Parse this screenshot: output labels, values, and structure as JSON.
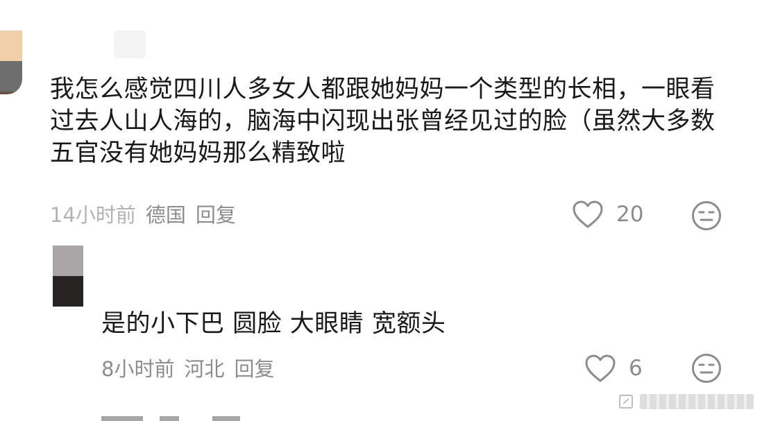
{
  "comment": {
    "text": "我怎么感觉四川人多女人都跟她妈妈一个类型的长相，一眼看过去人山人海的，脑海中闪现出张曾经见过的脸（虽然大多数五官没有她妈妈那么精致啦",
    "time": "14小时前",
    "location": "德国",
    "reply_label": "回复",
    "like_count": "20",
    "like_icon": "heart-outline-icon",
    "reaction_icon": "neutral-face-icon"
  },
  "reply": {
    "text": "是的小下巴 圆脸 大眼睛 宽额头",
    "time": "8小时前",
    "location": "河北",
    "reply_label": "回复",
    "like_count": "6",
    "like_icon": "heart-outline-icon",
    "reaction_icon": "neutral-face-icon"
  },
  "colors": {
    "text_primary": "#191919",
    "text_secondary": "#8c8c8c",
    "icon": "#8c8c8c"
  }
}
